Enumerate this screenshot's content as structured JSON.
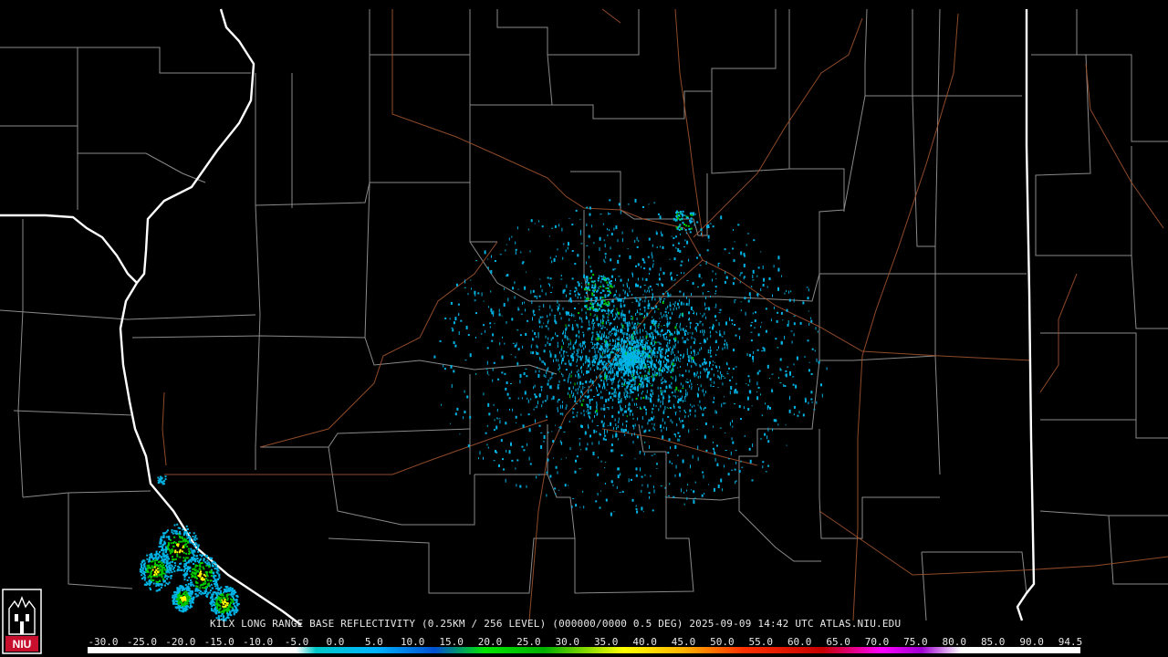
{
  "caption": "KILX LONG RANGE BASE REFLECTIVITY (0.25KM / 256 LEVEL) (000000/0000 0.5 DEG) 2025-09-09 14:42 UTC  ATLAS.NIU.EDU",
  "logo_text": "NIU",
  "scale": {
    "labels": [
      "-30.0",
      "-25.0",
      "-20.0",
      "-15.0",
      "-10.0",
      "-5.0",
      "0.0",
      "5.0",
      "10.0",
      "15.0",
      "20.0",
      "25.0",
      "30.0",
      "35.0",
      "40.0",
      "45.0",
      "50.0",
      "55.0",
      "60.0",
      "65.0",
      "70.0",
      "75.0",
      "80.0",
      "85.0",
      "90.0",
      "94.5"
    ]
  },
  "colors": {
    "background": "#000000",
    "county_lines": "#8a8a8a",
    "state_lines": "#ffffff",
    "highways": "#a0522d",
    "echo_weak": "#00b4e6",
    "echo_moderate": "#00c800",
    "echo_strong": "#ffff00",
    "logo_red": "#c8102e"
  }
}
